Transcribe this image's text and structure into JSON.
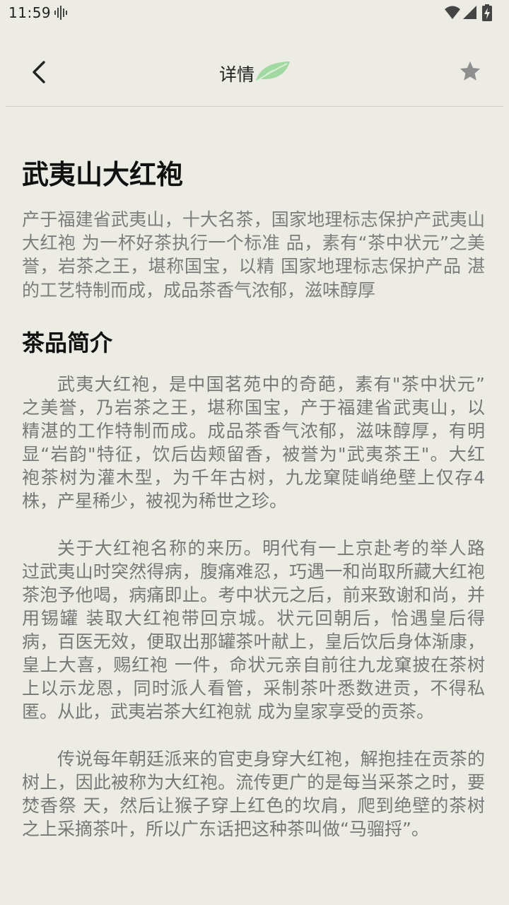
{
  "status_bar": {
    "time": "11:59"
  },
  "app_bar": {
    "title": "详情"
  },
  "colors": {
    "background": "#ecece4",
    "leaf": "#8fd08e",
    "summary_text": "#7c7c7c",
    "body_text": "#777777"
  },
  "icons": [
    "chevron-left-icon",
    "leaf-icon",
    "star-icon",
    "voice-icon",
    "wifi-icon",
    "signal-icon",
    "battery-charging-icon"
  ],
  "article": {
    "title": "武夷山大红袍",
    "summary": "产于福建省武夷山，十大名茶，国家地理标志保护产武夷山大红袍 为一杯好茶执行一个标准 品，素有“茶中状元”之美誉，岩茶之王，堪称国宝，以精 国家地理标志保护产品 湛的工艺特制而成，成品茶香气浓郁，滋味醇厚",
    "section_title": "茶品简介",
    "paragraphs": [
      "武夷大红袍，是中国茗苑中的奇葩，素有\"茶中状元” 之美誉，乃岩茶之王，堪称国宝，产于福建省武夷山，以 精湛的工作特制而成。成品茶香气浓郁，滋味醇厚，有明 显“岩韵\"特征，饮后齿颊留香，被誉为\"武夷茶王\"。大红 袍茶树为灌木型，为千年古树，九龙窠陡峭绝壁上仅存4 株，产星稀少，被视为稀世之珍。",
      "关于大红袍名称的来历。明代有一上京赴考的举人路 过武夷山时突然得病，腹痛难忍，巧遇一和尚取所藏大红袍茶泡予他喝，病痛即止。考中状元之后，前来致谢和尚，并用锡罐 装取大红袍带回京城。状元回朝后，恰遇皇后得病，百医无效，便取出那罐茶叶献上，皇后饮后身体渐康，皇上大喜，赐红袍 一件，命状元亲自前往九龙窠披在茶树上以示龙恩，同时派人看管，采制茶叶悉数进贡，不得私匿。从此，武夷岩茶大红袍就 成为皇家享受的贡茶。",
      "传说每年朝廷派来的官吏身穿大红袍，解抱挂在贡茶的树上，因此被称为大红袍。流传更广的是每当采茶之时，要焚香祭 天，然后让猴子穿上红色的坎肩，爬到绝壁的茶树之上采摘茶叶，所以广东话把这种茶叫做“马骝捋”。"
    ]
  }
}
